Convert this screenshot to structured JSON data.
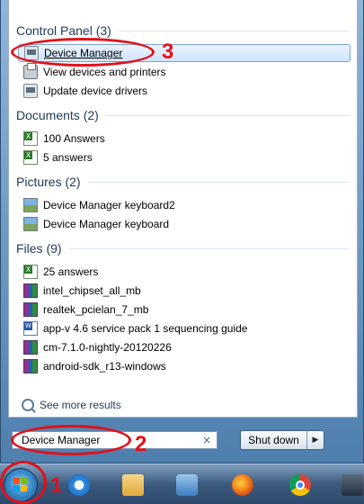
{
  "groups": [
    {
      "title": "Control Panel (3)",
      "items": [
        {
          "label": "Device Manager",
          "icon": "device-manager-icon",
          "selected": true
        },
        {
          "label": "View devices and printers",
          "icon": "printer-icon"
        },
        {
          "label": "Update device drivers",
          "icon": "device-driver-icon"
        }
      ]
    },
    {
      "title": "Documents (2)",
      "items": [
        {
          "label": "100 Answers",
          "icon": "excel-file-icon"
        },
        {
          "label": "5 answers",
          "icon": "excel-file-icon"
        }
      ]
    },
    {
      "title": "Pictures (2)",
      "items": [
        {
          "label": "Device Manager keyboard2",
          "icon": "image-file-icon"
        },
        {
          "label": "Device Manager keyboard",
          "icon": "image-file-icon"
        }
      ]
    },
    {
      "title": "Files (9)",
      "items": [
        {
          "label": "25 answers",
          "icon": "excel-file-icon"
        },
        {
          "label": "intel_chipset_all_mb",
          "icon": "archive-file-icon"
        },
        {
          "label": "realtek_pcielan_7_mb",
          "icon": "archive-file-icon"
        },
        {
          "label": "app-v 4.6 service pack 1 sequencing guide",
          "icon": "word-file-icon"
        },
        {
          "label": "cm-7.1.0-nightly-20120226",
          "icon": "archive-file-icon"
        },
        {
          "label": "android-sdk_r13-windows",
          "icon": "archive-file-icon"
        }
      ]
    }
  ],
  "see_more": "See more results",
  "search": {
    "value": "Device Manager",
    "clear": "×"
  },
  "shutdown": {
    "label": "Shut down",
    "arrow": "▶"
  },
  "taskbar": {
    "buttons": [
      "start-orb",
      "internet-explorer-icon",
      "windows-explorer-icon",
      "media-player-icon",
      "firefox-icon",
      "chrome-icon",
      "game-icon"
    ]
  },
  "annotations": {
    "step1": "1",
    "step2": "2",
    "step3": "3",
    "color": "#e0111a"
  }
}
